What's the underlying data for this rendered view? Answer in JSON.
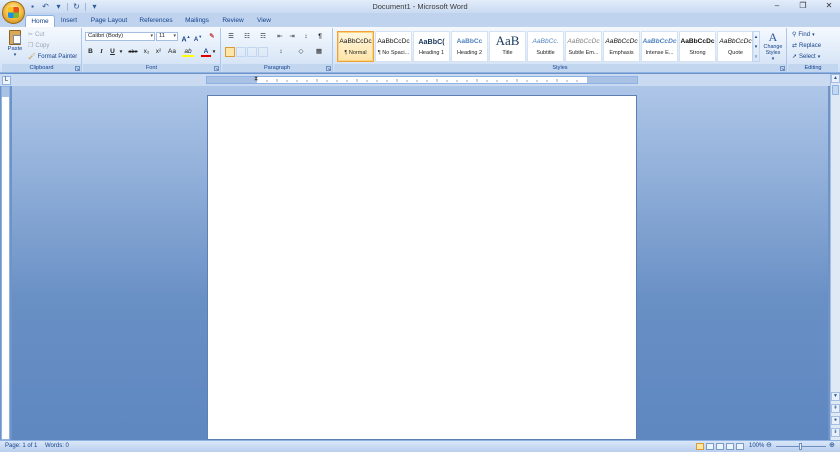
{
  "window": {
    "title": "Document1 - Microsoft Word",
    "controls": {
      "minimize": "–",
      "restore": "❐",
      "close": "✕"
    }
  },
  "quick_access": {
    "items": [
      {
        "name": "save-icon",
        "glyph": "▪"
      },
      {
        "name": "undo-icon",
        "glyph": "↶"
      },
      {
        "name": "undo-dropdown-icon",
        "glyph": "▾"
      },
      {
        "name": "redo-icon",
        "glyph": "↻"
      },
      {
        "name": "customize-qat-icon",
        "glyph": "▾"
      }
    ]
  },
  "tabs": [
    "Home",
    "Insert",
    "Page Layout",
    "References",
    "Mailings",
    "Review",
    "View"
  ],
  "clipboard": {
    "paste": "Paste",
    "cut": "Cut",
    "copy": "Copy",
    "format_painter": "Format Painter",
    "label": "Clipboard"
  },
  "font": {
    "family": "Calibri (Body)",
    "size": "11",
    "grow": "A",
    "shrink": "A",
    "clear": "✎",
    "bold": "B",
    "italic": "I",
    "underline": "U",
    "strikethrough": "abe",
    "subscript": "x₂",
    "superscript": "x²",
    "change_case": "Aa",
    "highlight": "ab",
    "font_color": "A",
    "label": "Font"
  },
  "paragraph": {
    "bullets": "☰",
    "numbering": "☷",
    "multilevel": "☶",
    "decrease_indent": "⇤",
    "increase_indent": "⇥",
    "sort": "↕",
    "show_marks": "¶",
    "line_spacing": "↕",
    "shading": "◇",
    "borders": "▦",
    "label": "Paragraph"
  },
  "styles": {
    "items": [
      {
        "preview": "AaBbCcDc",
        "name": "¶ Normal"
      },
      {
        "preview": "AaBbCcDc",
        "name": "¶ No Spaci..."
      },
      {
        "preview": "AaBbC(",
        "name": "Heading 1"
      },
      {
        "preview": "AaBbCc",
        "name": "Heading 2"
      },
      {
        "preview": "AaB",
        "name": "Title"
      },
      {
        "preview": "AaBbCc.",
        "name": "Subtitle"
      },
      {
        "preview": "AaBbCcDc",
        "name": "Subtle Em..."
      },
      {
        "preview": "AaBbCcDc",
        "name": "Emphasis"
      },
      {
        "preview": "AaBbCcDc",
        "name": "Intense E..."
      },
      {
        "preview": "AaBbCcDc",
        "name": "Strong"
      },
      {
        "preview": "AaBbCcDc",
        "name": "Quote"
      }
    ],
    "change_styles": "Change Styles",
    "label": "Styles"
  },
  "editing": {
    "find": "Find",
    "replace": "Replace",
    "select": "Select",
    "label": "Editing"
  },
  "status": {
    "page": "Page: 1 of 1",
    "words": "Words: 0",
    "zoom": "100%"
  },
  "colors": {
    "accent": "#15428b",
    "workspace": "#6d93c7",
    "highlight": "#ffff00",
    "font_color": "#e00000"
  }
}
